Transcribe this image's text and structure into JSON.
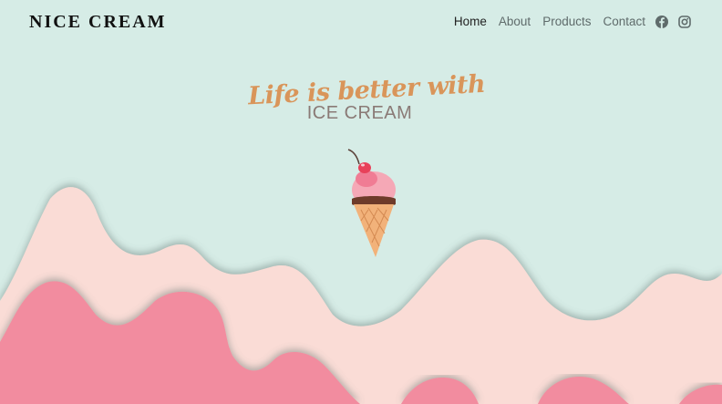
{
  "header": {
    "brand": "NICE CREAM",
    "nav": [
      "Home",
      "About",
      "Products",
      "Contact"
    ],
    "active": "Home",
    "social": [
      "facebook-icon",
      "instagram-icon"
    ]
  },
  "hero": {
    "line1": "Life is better with",
    "line2": "ICE CREAM"
  },
  "colors": {
    "background": "#d6ece6",
    "wave_light": "#fadcd6",
    "wave_pink": "#f28c9f",
    "script_text": "#d9955a"
  }
}
